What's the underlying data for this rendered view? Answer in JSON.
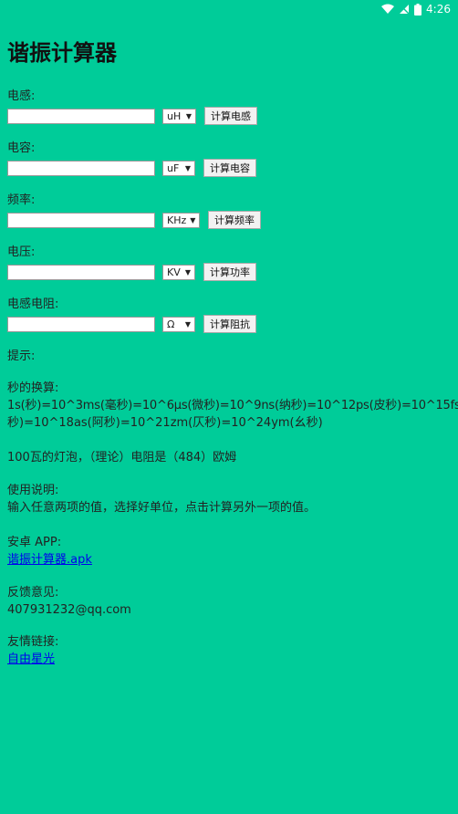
{
  "status": {
    "time": "4:26"
  },
  "title": "谐振计算器",
  "fields": [
    {
      "label": "电感:",
      "unit": "uH",
      "button": "计算电感"
    },
    {
      "label": "电容:",
      "unit": "uF",
      "button": "计算电容"
    },
    {
      "label": "频率:",
      "unit": "KHz",
      "button": "计算频率"
    },
    {
      "label": "电压:",
      "unit": "KV",
      "button": "计算功率"
    },
    {
      "label": "电感电阻:",
      "unit": "Ω",
      "button": "计算阻抗"
    }
  ],
  "hint": {
    "label": "提示:"
  },
  "seconds": {
    "label": "秒的换算:",
    "line1": "1s(秒)=10^3ms(毫秒)=10^6μs(微秒)=10^9ns(纳秒)=10^12ps(皮秒)=10^15fs(飞",
    "line2": "秒)=10^18as(阿秒)=10^21zm(仄秒)=10^24ym(幺秒)"
  },
  "bulb_note": "100瓦的灯泡，（理论）电阻是（484）欧姆",
  "usage": {
    "label": "使用说明:",
    "text": "输入任意两项的值，选择好单位，点击计算另外一项的值。"
  },
  "android": {
    "label": "安卓 APP:",
    "link": "谐振计算器.apk"
  },
  "feedback": {
    "label": "反馈意见:",
    "email": "407931232@qq.com"
  },
  "friends": {
    "label": "友情链接:",
    "link": "自由星光"
  },
  "colors": {
    "background": "#00CC99",
    "link": "#0000EE"
  }
}
